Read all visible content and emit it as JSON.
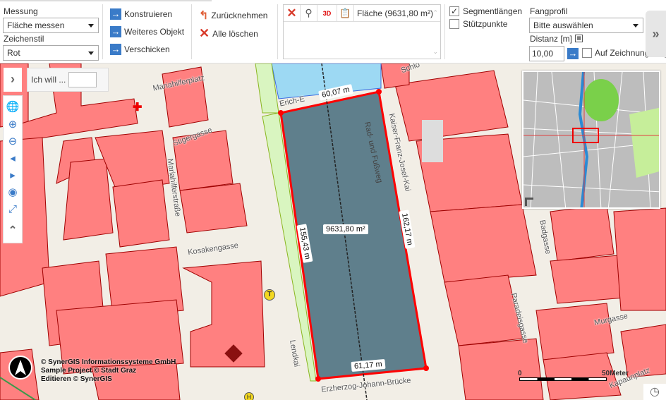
{
  "toolbar": {
    "measure_label": "Messung",
    "measure_value": "Fläche messen",
    "style_label": "Zeichenstil",
    "style_value": "Rot",
    "actions": [
      {
        "label": "Konstruieren",
        "icon": "arrow-right-icon"
      },
      {
        "label": "Weiteres Objekt",
        "icon": "arrow-right-icon"
      },
      {
        "label": "Verschicken",
        "icon": "arrow-right-icon"
      }
    ],
    "undo_label": "Zurücknehmen",
    "clear_label": "Alle löschen",
    "result_item": "Fläche (9631,80 m²)",
    "segment_lengths": {
      "label": "Segmentlängen",
      "checked": true
    },
    "vertices": {
      "label": "Stützpunkte",
      "checked": false
    },
    "snap_label": "Fangprofil",
    "snap_value": "Bitte auswählen",
    "distance_label": "Distanz [m]",
    "distance_value": "10,00",
    "on_drawing_label": "Auf Zeichnung fang"
  },
  "map": {
    "search_label": "Ich will ...",
    "search_value": "",
    "measurements": {
      "top": "60,07 m",
      "left": "155,43 m",
      "right": "162,17 m",
      "bottom": "61,17 m",
      "area": "9631,80 m²"
    },
    "streets": [
      "Mariahilferplatz",
      "Stigergasse",
      "Mariahilferstraße",
      "Kosakengasse",
      "Erich-E",
      "Kaiser-Franz-Josef-Kai",
      "Rad- und Fußweg",
      "Lendkai",
      "Erzherzog-Johann-Brücke",
      "Badgasse",
      "Paradeisgasse",
      "Murgasse",
      "Kapaunplatz",
      "Schlo"
    ],
    "copyright": [
      "© SynerGIS Informationssysteme GmbH",
      "Sample Project © Stadt Graz",
      "Editieren © SynerGIS"
    ],
    "scale": {
      "start": "0",
      "end": "50Meter"
    },
    "colors": {
      "building": "#ff8080",
      "measure": "#ff0000",
      "area_fill": "#5f7f8c",
      "water": "#9dd9f3",
      "park": "#d9f5c0"
    }
  }
}
